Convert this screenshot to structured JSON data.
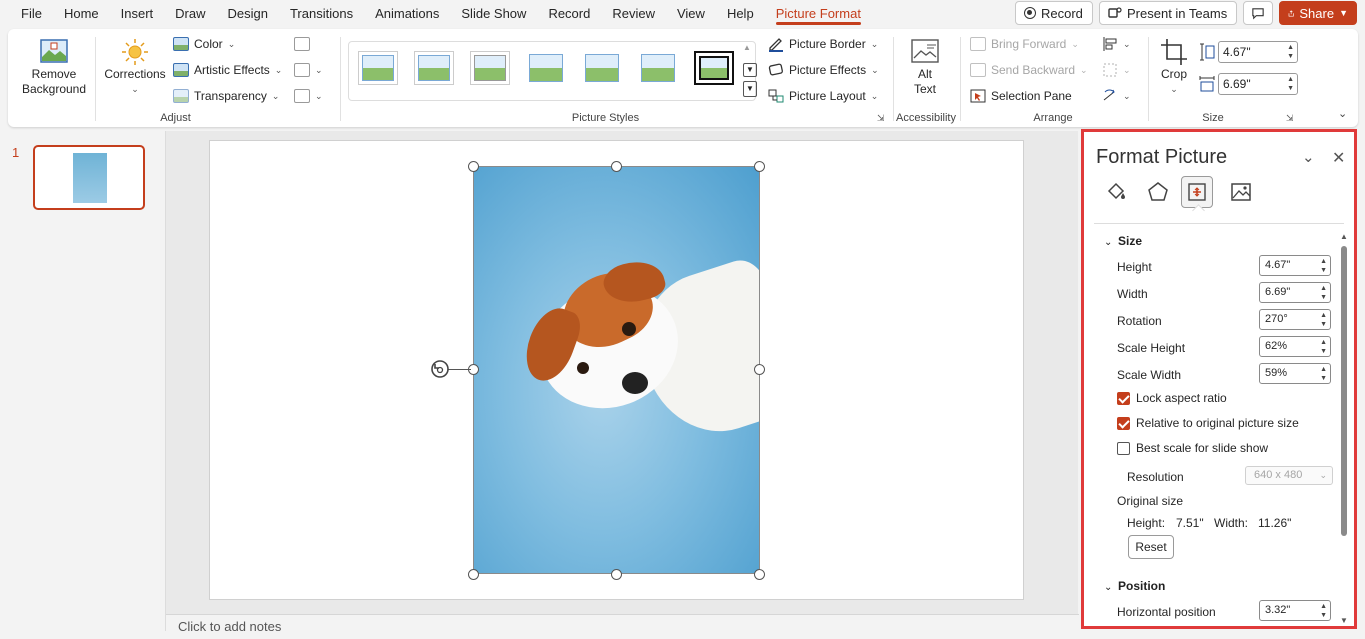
{
  "menu": {
    "tabs": [
      "File",
      "Home",
      "Insert",
      "Draw",
      "Design",
      "Transitions",
      "Animations",
      "Slide Show",
      "Record",
      "Review",
      "View",
      "Help",
      "Picture Format"
    ],
    "active_tab": "Picture Format",
    "record_label": "Record",
    "present_label": "Present in Teams",
    "share_label": "Share"
  },
  "ribbon": {
    "adjust": {
      "label": "Adjust",
      "remove_bg_line1": "Remove",
      "remove_bg_line2": "Background",
      "corrections": "Corrections",
      "color": "Color",
      "artistic": "Artistic Effects",
      "transparency": "Transparency"
    },
    "picture_styles": {
      "label": "Picture Styles",
      "border": "Picture Border",
      "effects": "Picture Effects",
      "layout": "Picture Layout"
    },
    "accessibility": {
      "label": "Accessibility",
      "alt_line1": "Alt",
      "alt_line2": "Text"
    },
    "arrange": {
      "label": "Arrange",
      "bring_forward": "Bring Forward",
      "send_backward": "Send Backward",
      "selection_pane": "Selection Pane"
    },
    "size": {
      "label": "Size",
      "crop": "Crop",
      "height": "4.67\"",
      "width": "6.69\""
    }
  },
  "slides": {
    "number": "1"
  },
  "notes_placeholder": "Click to add notes",
  "pane": {
    "title": "Format Picture",
    "size_section": "Size",
    "height_label": "Height",
    "height_value": "4.67\"",
    "width_label": "Width",
    "width_value": "6.69\"",
    "rotation_label": "Rotation",
    "rotation_value": "270°",
    "scale_height_label": "Scale Height",
    "scale_height_value": "62%",
    "scale_width_label": "Scale Width",
    "scale_width_value": "59%",
    "lock_aspect": "Lock aspect ratio",
    "lock_aspect_checked": true,
    "relative_original": "Relative to original picture size",
    "relative_original_checked": true,
    "best_scale": "Best scale for slide show",
    "best_scale_checked": false,
    "resolution_label": "Resolution",
    "resolution_value": "640 x 480",
    "original_size_label": "Original size",
    "orig_height_label": "Height:",
    "orig_height_value": "7.51\"",
    "orig_width_label": "Width:",
    "orig_width_value": "11.26\"",
    "reset_label": "Reset",
    "position_section": "Position",
    "horiz_label": "Horizontal position",
    "horiz_value": "3.32\""
  },
  "colors": {
    "accent": "#c43e1c",
    "highlight_border": "#e03a3a"
  }
}
